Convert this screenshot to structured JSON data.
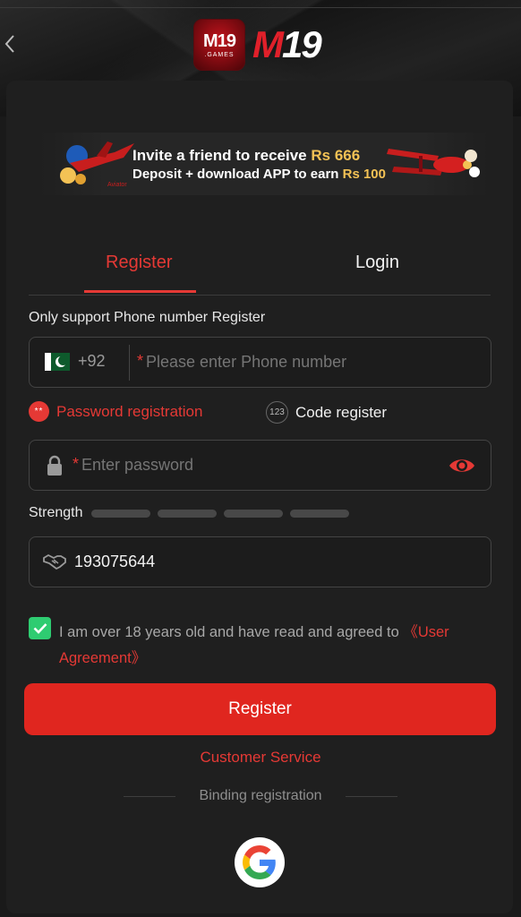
{
  "header": {
    "logo_badge_text": "M19",
    "logo_badge_sub": ".GAMES",
    "logo_text_a": "M",
    "logo_text_b": "19"
  },
  "banner": {
    "line1_prefix": "Invite a friend to receive",
    "line1_amount": "Rs 666",
    "line2_prefix": "Deposit + download APP to earn",
    "line2_amount": "Rs 100",
    "left_tag": "Aviator"
  },
  "tabs": {
    "register": "Register",
    "login": "Login"
  },
  "hint": "Only support Phone number Register",
  "phone": {
    "country_code": "+92",
    "required_mark": "*",
    "placeholder": "Please enter Phone number"
  },
  "modes": {
    "password_icon": "**",
    "password_label": "Password registration",
    "code_icon": "123",
    "code_label": "Code register"
  },
  "password": {
    "required_mark": "*",
    "placeholder": "Enter password"
  },
  "strength": {
    "label": "Strength",
    "level": 0
  },
  "invite": {
    "value": "193075644"
  },
  "agreement": {
    "checked": true,
    "text": "I am over 18 years old and have read and agreed to ",
    "link": "《User Agreement》"
  },
  "register_button": "Register",
  "customer_service": "Customer Service",
  "binding": "Binding registration",
  "colors": {
    "accent": "#e0261f",
    "link": "#e53935",
    "check": "#2ecc71",
    "gold": "#f3c255"
  }
}
